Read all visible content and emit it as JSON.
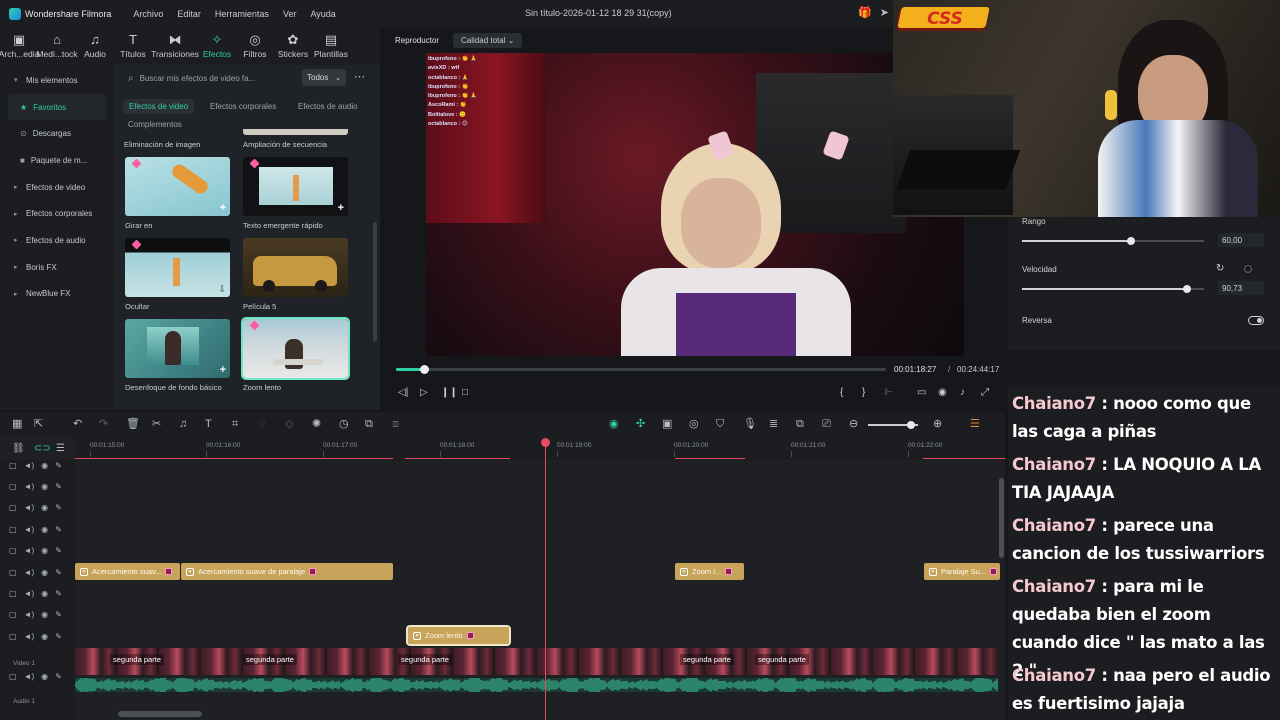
{
  "app": {
    "name": "Wondershare Filmora",
    "menus": [
      "Archivo",
      "Editar",
      "Herramientas",
      "Ver",
      "Ayuda"
    ],
    "document_title": "Sin título-2026-01-12 18 29 31(copy)"
  },
  "toolstrip": [
    {
      "label": "Arch...edia",
      "icon": "folder-icon"
    },
    {
      "label": "Medi...tock",
      "icon": "media-stock-icon"
    },
    {
      "label": "Audio",
      "icon": "music-note-icon"
    },
    {
      "label": "Títulos",
      "icon": "title-icon"
    },
    {
      "label": "Transiciones",
      "icon": "transition-icon"
    },
    {
      "label": "Efectos",
      "icon": "effects-icon",
      "active": true
    },
    {
      "label": "Filtros",
      "icon": "filter-icon"
    },
    {
      "label": "Stickers",
      "icon": "sticker-icon"
    },
    {
      "label": "Plantillas",
      "icon": "template-icon"
    }
  ],
  "sidebar": {
    "items": [
      {
        "label": "Mis elementos",
        "chevron": "▾"
      },
      {
        "label": "Favoritos",
        "icon": "★",
        "favorite": true
      },
      {
        "label": "Descargas",
        "icon": "⊙"
      },
      {
        "label": "Paquete de m...",
        "icon": "■"
      },
      {
        "label": "Efectos de video",
        "chevron": "▸"
      },
      {
        "label": "Efectos corporales",
        "chevron": "▸"
      },
      {
        "label": "Efectos de audio",
        "chevron": "▸"
      },
      {
        "label": "Boris FX",
        "chevron": "▸"
      },
      {
        "label": "NewBlue FX",
        "chevron": "▸"
      }
    ]
  },
  "browser": {
    "search_placeholder": "Buscar mis efectos de video fa...",
    "filter_value": "Todos",
    "tabs": [
      "Efectos de video",
      "Efectos corporales",
      "Efectos de audio",
      "Complementos"
    ],
    "active_tab": "Efectos de video",
    "top_labels": [
      "Eliminación de imagen",
      "Ampliación de secuencia"
    ],
    "cards": [
      {
        "label": "Girar en",
        "premium": true
      },
      {
        "label": "Texto emergente rápido",
        "premium": true
      },
      {
        "label": "Ocultar",
        "premium": true
      },
      {
        "label": "Película 5",
        "premium": false
      },
      {
        "label": "Desenfoque de fondo básico",
        "premium": false
      },
      {
        "label": "Zoom lento",
        "premium": true,
        "selected": true
      }
    ]
  },
  "player": {
    "tab_label": "Reproductor",
    "quality": "Calidad total",
    "current_time": "00:01:18:27",
    "separator": "/",
    "total_time": "00:24:44:17",
    "progress_fraction": 0.057,
    "overlay_chat": [
      "ibuprofeno : 👏 🙏",
      "avisXD : wtf",
      "octablanco : 🙏",
      "ibuprofeno : 👏",
      "ibuprofeno : 👏 🙏",
      "AscoRami : 👏",
      "Bolitalove : 🙂",
      "octablanco : 😊"
    ]
  },
  "properties": {
    "rango_label": "Rango",
    "rango_value": "60,00",
    "rango_fraction": 0.6,
    "velocidad_label": "Velocidad",
    "velocidad_value": "90,73",
    "velocidad_fraction": 0.9073,
    "reversa_label": "Reversa"
  },
  "overlay_logo": "CSS",
  "stream_chat": [
    {
      "user": "Chaiano7",
      "text": ": nooo como que las caga a piñas"
    },
    {
      "user": "Chaiano7",
      "text": ": LA NOQUIO A LA TIA JAJAAJA"
    },
    {
      "user": "Chaiano7",
      "text": ": parece una cancion de los tussiwarriors"
    },
    {
      "user": "Chaiano7",
      "text": ": para mi le quedaba bien el zoom cuando dice \" las mato a las 2 \""
    },
    {
      "user": "Chaiano7",
      "text": ": naa pero el audio es fuertisimo jajaja"
    }
  ],
  "timeline": {
    "ruler_labels": [
      "00:01:15:00",
      "00:01:16:00",
      "00:01:17:00",
      "00:01:18:00",
      "00:01:19:00",
      "00:01:20:00",
      "00:01:21:00",
      "00:01:22:00"
    ],
    "fx_clips_row1": [
      {
        "label": "Acercamiento suav..."
      },
      {
        "label": "Acercamiento suave de paralaje"
      },
      {
        "label": "Zoom l..."
      },
      {
        "label": "Paralaje Su..."
      }
    ],
    "fx_clip_row2": {
      "label": "Zoom lento"
    },
    "video_clip_labels": [
      "segunda parte",
      "segunda parte",
      "segunda parte",
      "segunda parte",
      "segunda parte"
    ],
    "video_track_label": "Video 1",
    "audio_track_label": "Audio 1"
  }
}
